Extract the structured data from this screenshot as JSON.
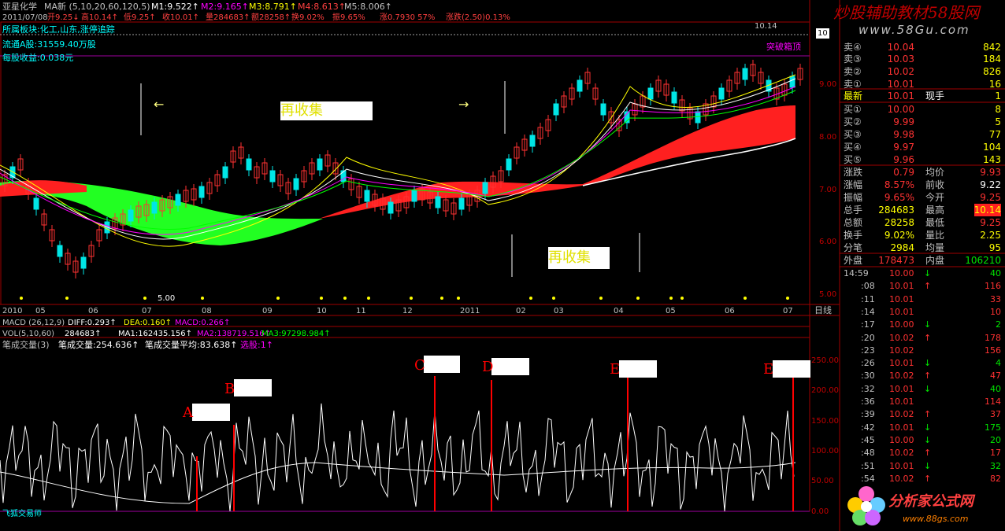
{
  "stock": {
    "name": "亚星化学",
    "ma_label": "MA新 (5,10,20,60,120,5)",
    "m1": "M1:9.522↑",
    "m2": "M2:9.165↑",
    "m3": "M3:8.791↑",
    "m4": "M4:8.613↑",
    "m5": "M5:8.006↑",
    "date_line": "2011/07/08",
    "open": "开9.25↓",
    "high": "高10.14↑",
    "low": "低9.25↑",
    "close": "收10.01↑",
    "vol": "量284683↑",
    "amount": "额28258↑",
    "turnover": "换9.02%",
    "amplitude": "振9.65%",
    "rise": "涨0.7930 57%",
    "tip": "涨跌(2.50)0.13%"
  },
  "info": {
    "sector": "所属板块:化工,山东,涨停追踪",
    "float": "流通A股:31559.40万股",
    "eps": "每股收益:0.038元"
  },
  "annotations": {
    "low_value": "5.00",
    "high_value": "10.14",
    "breakout": "突破箱顶",
    "convergence1": "再收集",
    "convergence2": "再收集",
    "arrow_left": "←",
    "arrow_right": "→"
  },
  "price_axis": [
    "10",
    "9.00",
    "8.00",
    "7.00",
    "6.00",
    "5.00"
  ],
  "time_axis": [
    "2010",
    "05",
    "06",
    "07",
    "08",
    "09",
    "10",
    "11",
    "12",
    "2011",
    "02",
    "03",
    "04",
    "05",
    "06",
    "07"
  ],
  "period": "日线",
  "indicators": {
    "macd": "MACD (26,12,9)",
    "diff": "DIFF:0.293↑",
    "dea": "DEA:0.160↑",
    "macd_val": "MACD:0.266↑",
    "vol": "VOL(5,10,60)",
    "vol_val": "284683↑",
    "ma1": "MA1:162435.156↑",
    "ma2": "MA2:138719.516↑",
    "ma3": "MA3:97298.984↑",
    "bicheng": "笔成交量(3)",
    "bicheng_val": "笔成交量:254.636↑",
    "bicheng_avg": "笔成交量平均:83.638↑",
    "select": "选股:1↑"
  },
  "lower_axis": [
    "250.00",
    "200.00",
    "150.00",
    "100.00",
    "50.00",
    "0.00"
  ],
  "lower_marks": [
    "A",
    "B",
    "C",
    "D",
    "E",
    "E"
  ],
  "footer_label": "飞狐交易师",
  "watermarks": {
    "top": "炒股辅助教材58股网",
    "top_url": "www.58Gu.com",
    "bottom": "分析家公式网",
    "bottom_url": "www.88gs.com"
  },
  "quote": {
    "sells": [
      {
        "label": "卖④",
        "price": "10.04",
        "vol": "842"
      },
      {
        "label": "卖③",
        "price": "10.03",
        "vol": "184"
      },
      {
        "label": "卖②",
        "price": "10.02",
        "vol": "826"
      },
      {
        "label": "卖①",
        "price": "10.01",
        "vol": "16"
      }
    ],
    "latest": {
      "label": "最新",
      "price": "10.01",
      "label2": "现手",
      "vol": "1"
    },
    "buys": [
      {
        "label": "买①",
        "price": "10.00",
        "vol": "8"
      },
      {
        "label": "买②",
        "price": "9.99",
        "vol": "5"
      },
      {
        "label": "买③",
        "price": "9.98",
        "vol": "77"
      },
      {
        "label": "买④",
        "price": "9.97",
        "vol": "104"
      },
      {
        "label": "买⑤",
        "price": "9.96",
        "vol": "143"
      }
    ],
    "stats": [
      {
        "l1": "涨跌",
        "v1": "0.79",
        "l2": "均价",
        "v2": "9.93"
      },
      {
        "l1": "涨幅",
        "v1": "8.57%",
        "l2": "前收",
        "v2": "9.22"
      },
      {
        "l1": "振幅",
        "v1": "9.65%",
        "l2": "今开",
        "v2": "9.25"
      },
      {
        "l1": "总手",
        "v1": "284683",
        "l2": "最高",
        "v2": "10.14"
      },
      {
        "l1": "总额",
        "v1": "28258",
        "l2": "最低",
        "v2": "9.25"
      },
      {
        "l1": "换手",
        "v1": "9.02%",
        "l2": "量比",
        "v2": "2.25"
      },
      {
        "l1": "分笔",
        "v1": "2984",
        "l2": "均量",
        "v2": "95"
      }
    ],
    "outer": {
      "l1": "外盘",
      "v1": "178473",
      "l2": "内盘",
      "v2": "106210"
    }
  },
  "ticks": [
    {
      "t": "14:59",
      "p": "10.00",
      "d": "↓",
      "v": "40"
    },
    {
      "t": ":08",
      "p": "10.01",
      "d": "↑",
      "v": "116"
    },
    {
      "t": ":11",
      "p": "10.01",
      "d": "",
      "v": "33"
    },
    {
      "t": ":14",
      "p": "10.01",
      "d": "",
      "v": "10"
    },
    {
      "t": ":17",
      "p": "10.00",
      "d": "↓",
      "v": "2"
    },
    {
      "t": ":20",
      "p": "10.02",
      "d": "↑",
      "v": "178"
    },
    {
      "t": ":23",
      "p": "10.02",
      "d": "",
      "v": "156"
    },
    {
      "t": ":26",
      "p": "10.01",
      "d": "↓",
      "v": "4"
    },
    {
      "t": ":30",
      "p": "10.02",
      "d": "↑",
      "v": "47"
    },
    {
      "t": ":32",
      "p": "10.01",
      "d": "↓",
      "v": "40"
    },
    {
      "t": ":36",
      "p": "10.01",
      "d": "",
      "v": "114"
    },
    {
      "t": ":39",
      "p": "10.02",
      "d": "↑",
      "v": "37"
    },
    {
      "t": ":42",
      "p": "10.01",
      "d": "↓",
      "v": "175"
    },
    {
      "t": ":45",
      "p": "10.00",
      "d": "↓",
      "v": "20"
    },
    {
      "t": ":48",
      "p": "10.02",
      "d": "↑",
      "v": "17"
    },
    {
      "t": ":51",
      "p": "10.01",
      "d": "↓",
      "v": "32"
    },
    {
      "t": ":54",
      "p": "10.02",
      "d": "↑",
      "v": "82"
    }
  ],
  "colors": {
    "up": "#ff3232",
    "down": "#00e600",
    "grid": "#a000a0",
    "axis": "#c00000"
  }
}
